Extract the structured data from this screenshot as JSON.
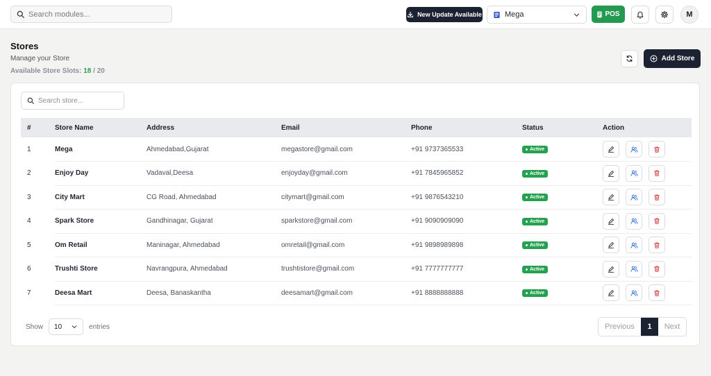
{
  "topbar": {
    "search_placeholder": "Search modules...",
    "update_label": "New Update Available",
    "store_select": "Mega",
    "pos_label": "POS",
    "avatar_initial": "M"
  },
  "header": {
    "title": "Stores",
    "subtitle": "Manage your Store",
    "slots_label": "Available Store Slots:",
    "slots_used": "18",
    "slots_sep": " / ",
    "slots_total": "20",
    "add_label": "Add Store"
  },
  "table": {
    "search_placeholder": "Search store...",
    "columns": [
      "#",
      "Store Name",
      "Address",
      "Email",
      "Phone",
      "Status",
      "Action"
    ],
    "rows": [
      {
        "num": "1",
        "name": "Mega",
        "address": "Ahmedabad,Gujarat",
        "email": "megastore@gmail.com",
        "phone": "+91 9737365533",
        "status": "Active"
      },
      {
        "num": "2",
        "name": "Enjoy Day",
        "address": "Vadaval,Deesa",
        "email": "enjoyday@gmail.com",
        "phone": "+91 7845965852",
        "status": "Active"
      },
      {
        "num": "3",
        "name": "City Mart",
        "address": "CG Road, Ahmedabad",
        "email": "citymart@gmail.com",
        "phone": "+91 9876543210",
        "status": "Active"
      },
      {
        "num": "4",
        "name": "Spark Store",
        "address": "Gandhinagar, Gujarat",
        "email": "sparkstore@gmail.com",
        "phone": "+91 9090909090",
        "status": "Active"
      },
      {
        "num": "5",
        "name": "Om Retail",
        "address": "Maninagar, Ahmedabad",
        "email": "omretail@gmail.com",
        "phone": "+91 9898989898",
        "status": "Active"
      },
      {
        "num": "6",
        "name": "Trushti Store",
        "address": "Navrangpura, Ahmedabad",
        "email": "trushtistore@gmail.com",
        "phone": "+91 7777777777",
        "status": "Active"
      },
      {
        "num": "7",
        "name": "Deesa Mart",
        "address": "Deesa, Banaskantha",
        "email": "deesamart@gmail.com",
        "phone": "+91 8888888888",
        "status": "Active"
      }
    ]
  },
  "footer": {
    "show_label": "Show",
    "page_size": "10",
    "entries_label": "entries",
    "prev_label": "Previous",
    "current_page": "1",
    "next_label": "Next"
  },
  "colors": {
    "accent_dark": "#1d2233",
    "success_green": "#26a14f",
    "edit_icon": "#333333",
    "users_icon": "#2f6fd6",
    "delete_icon": "#d63a3a"
  },
  "icons": {
    "search": "search-icon",
    "download": "download-icon",
    "store": "store-icon",
    "pos": "pos-icon",
    "bell": "bell-icon",
    "settings": "gear-icon",
    "refresh": "refresh-icon",
    "add": "plus-circle-icon",
    "edit": "edit-icon",
    "users": "users-icon",
    "delete": "trash-icon"
  }
}
